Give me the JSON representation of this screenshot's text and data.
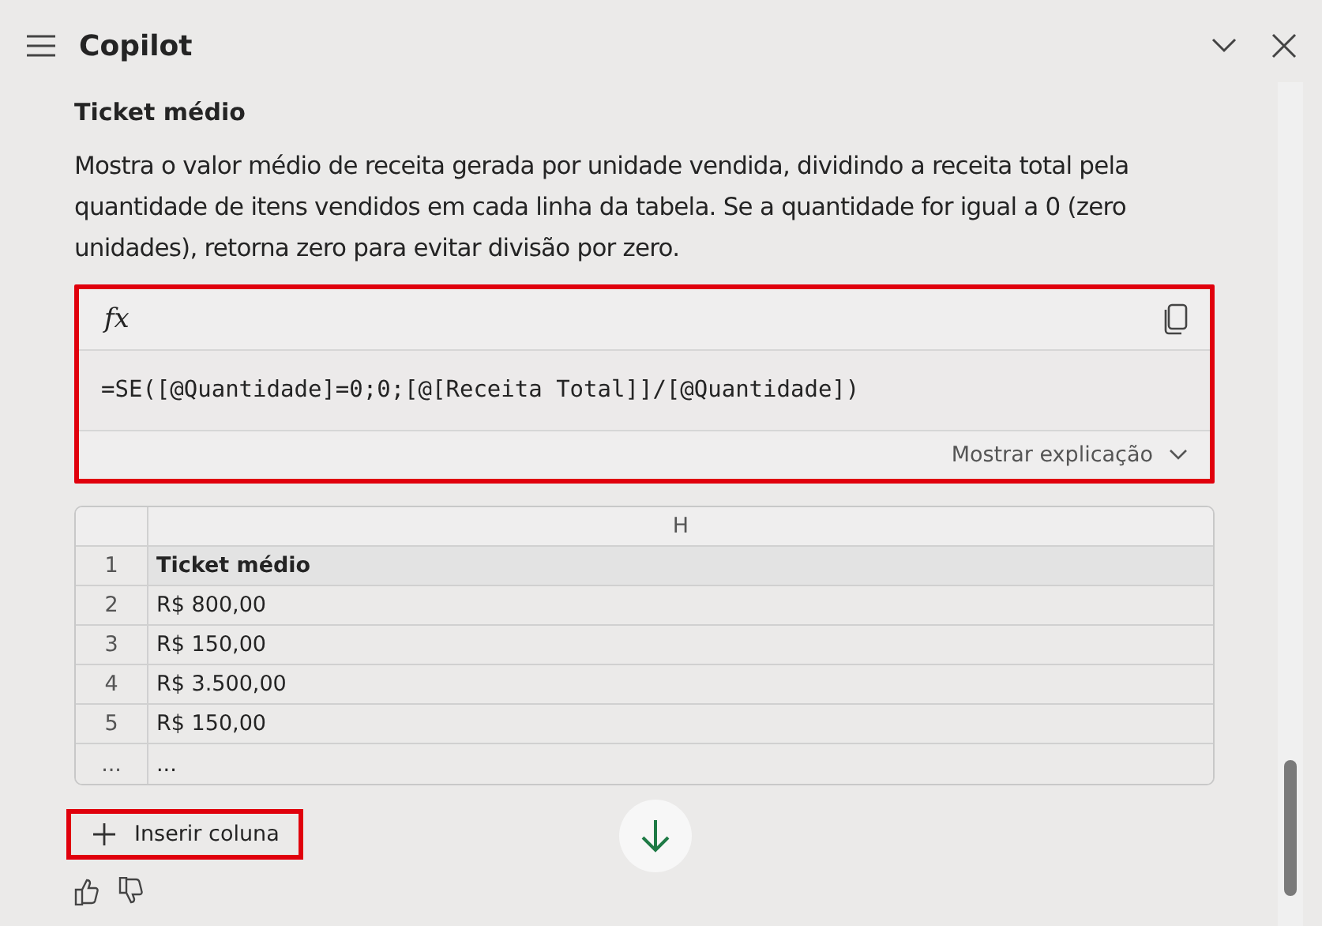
{
  "header": {
    "title": "Copilot"
  },
  "section": {
    "title": "Ticket médio",
    "description": "Mostra o valor médio de receita gerada por unidade vendida, dividindo a receita total pela quantidade de itens vendidos em cada linha da tabela. Se a quantidade for igual a 0 (zero unidades), retorna zero para evitar divisão por zero."
  },
  "formula": {
    "icon_label": "fx",
    "text": "=SE([@Quantidade]=0;0;[@[Receita Total]]/[@Quantidade])",
    "explain_label": "Mostrar explicação",
    "highlighted": true
  },
  "table": {
    "column": "H",
    "rows": [
      {
        "row": "1",
        "value": "Ticket médio",
        "kind": "header"
      },
      {
        "row": "2",
        "value": "R$ 800,00",
        "kind": "data"
      },
      {
        "row": "3",
        "value": "R$ 150,00",
        "kind": "data"
      },
      {
        "row": "4",
        "value": "R$ 3.500,00",
        "kind": "data"
      },
      {
        "row": "5",
        "value": "R$ 150,00",
        "kind": "data"
      },
      {
        "row": "...",
        "value": "...",
        "kind": "data"
      }
    ]
  },
  "insert_button": {
    "label": "Inserir coluna",
    "highlighted": true
  }
}
